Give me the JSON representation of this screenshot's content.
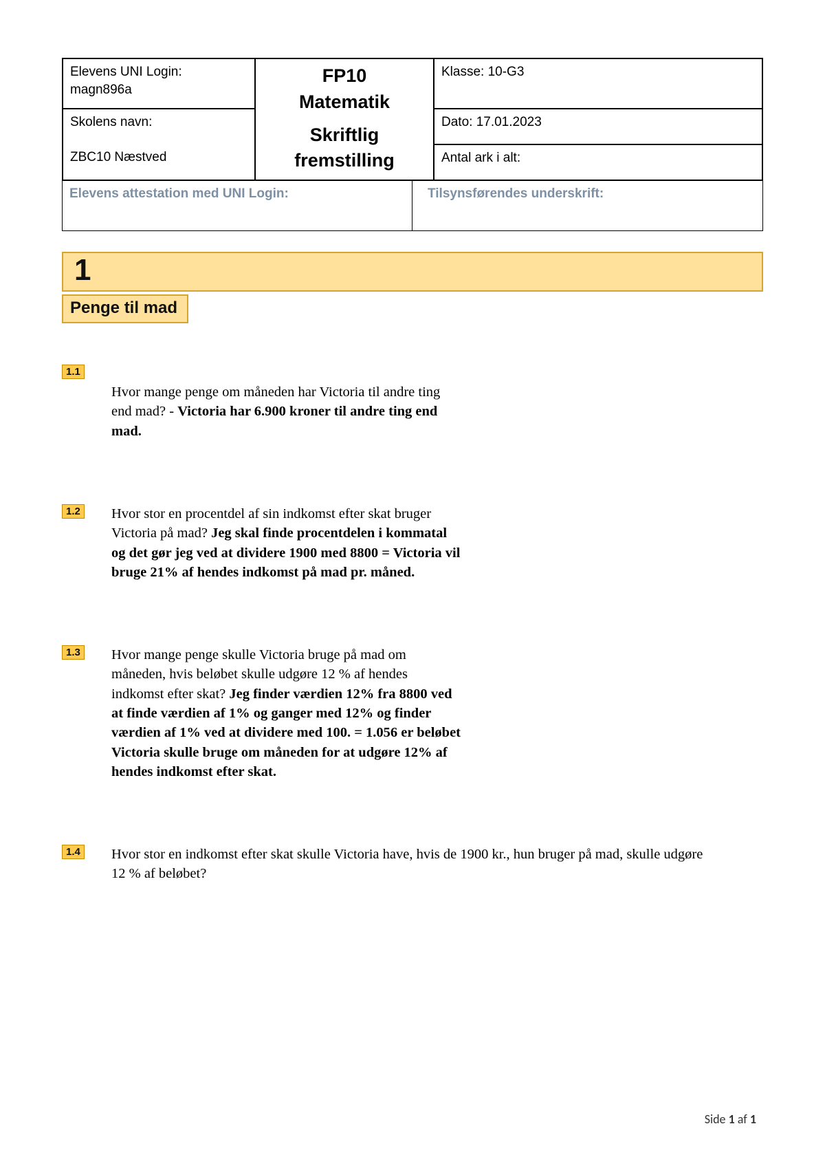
{
  "header": {
    "login_label": "Elevens UNI Login:",
    "login_value": "magn896a",
    "school_label": "Skolens navn:",
    "school_value": "ZBC10 Næstved",
    "title_line1": "FP10",
    "title_line2": "Matematik",
    "title_line3": "Skriftlig fremstilling",
    "klasse_label": "Klasse:",
    "klasse_value": "10-G3",
    "dato_label": "Dato:",
    "dato_value": "17.01.2023",
    "ark_label": "Antal ark i alt:",
    "attest_left": "Elevens attestation med UNI Login:",
    "attest_right": "Tilsynsførendes underskrift:"
  },
  "section": {
    "number": "1",
    "title": "Penge til mad"
  },
  "questions": {
    "q1": {
      "num": "1.1",
      "text": "Hvor mange penge om måneden har Victoria til andre ting end mad?  - ",
      "answer": "Victoria har 6.900 kroner til andre ting end mad."
    },
    "q2": {
      "num": "1.2",
      "text": "Hvor stor en procentdel af sin indkomst efter skat bruger Victoria på mad? ",
      "answer": "Jeg skal finde procentdelen i kommatal og det gør jeg ved at dividere 1900 med 8800  = Victoria vil bruge 21% af hendes indkomst på mad pr. måned."
    },
    "q3": {
      "num": "1.3",
      "text": "Hvor mange penge skulle Victoria bruge på mad om måneden, hvis beløbet skulle udgøre 12 % af hendes indkomst efter skat? ",
      "answer": "Jeg finder værdien 12% fra 8800 ved at finde værdien af 1% og ganger med 12% og finder værdien af 1% ved at dividere med 100.  = 1.056 er beløbet Victoria skulle bruge om måneden for at udgøre 12% af hendes indkomst efter skat."
    },
    "q4": {
      "num": "1.4",
      "text": "Hvor stor en indkomst efter skat skulle Victoria have, hvis de 1900 kr., hun bruger på mad, skulle udgøre 12 % af beløbet?"
    }
  },
  "footer": {
    "prefix": "Side ",
    "current": "1",
    "middle": " af ",
    "total": "1"
  }
}
